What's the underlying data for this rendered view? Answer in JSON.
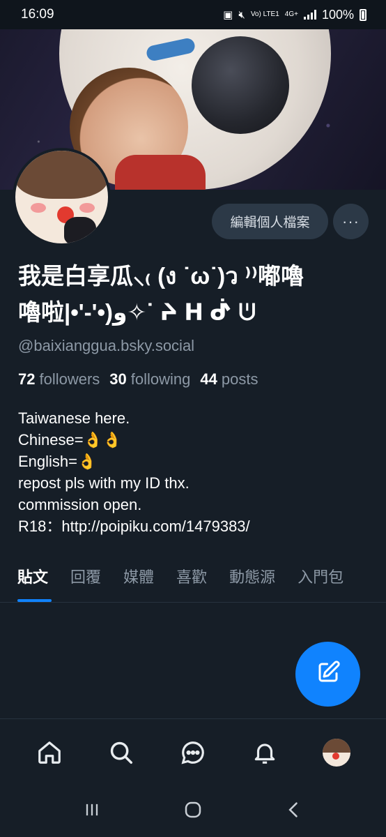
{
  "status_bar": {
    "time": "16:09",
    "network": "Vo) LTE1",
    "network_type": "4G+",
    "battery": "100%"
  },
  "profile": {
    "edit_button": "編輯個人檔案",
    "more_button": "···",
    "display_name_line1": "我是白享瓜⸜₍ (ง ˙ω˙)ว ⁾⁾嘟嚕",
    "display_name_line2": "嚕啦|•'-'•)و✧ᐝ ᔨ ᕼ ᕸ ᕫ",
    "handle": "@baixianggua.bsky.social",
    "stats": {
      "followers_count": "72",
      "followers_label": "followers",
      "following_count": "30",
      "following_label": "following",
      "posts_count": "44",
      "posts_label": "posts"
    },
    "bio": [
      "Taiwanese here.",
      "Chinese=👌👌",
      "English=👌",
      "repost pls with my ID thx.",
      "commission open.",
      "R18：http://poipiku.com/1479383/"
    ]
  },
  "tabs": [
    {
      "label": "貼文",
      "active": true
    },
    {
      "label": "回覆",
      "active": false
    },
    {
      "label": "媒體",
      "active": false
    },
    {
      "label": "喜歡",
      "active": false
    },
    {
      "label": "動態源",
      "active": false
    },
    {
      "label": "入門包",
      "active": false
    }
  ],
  "colors": {
    "background": "#161e27",
    "accent": "#1083fe",
    "muted_text": "#8d99a6",
    "button_bg": "#2c3947"
  },
  "icons": {
    "fab": "compose-icon",
    "nav": [
      "home-icon",
      "search-icon",
      "chat-icon",
      "bell-icon",
      "profile-avatar"
    ],
    "system": [
      "recents-icon",
      "home-circle-icon",
      "back-icon"
    ]
  }
}
